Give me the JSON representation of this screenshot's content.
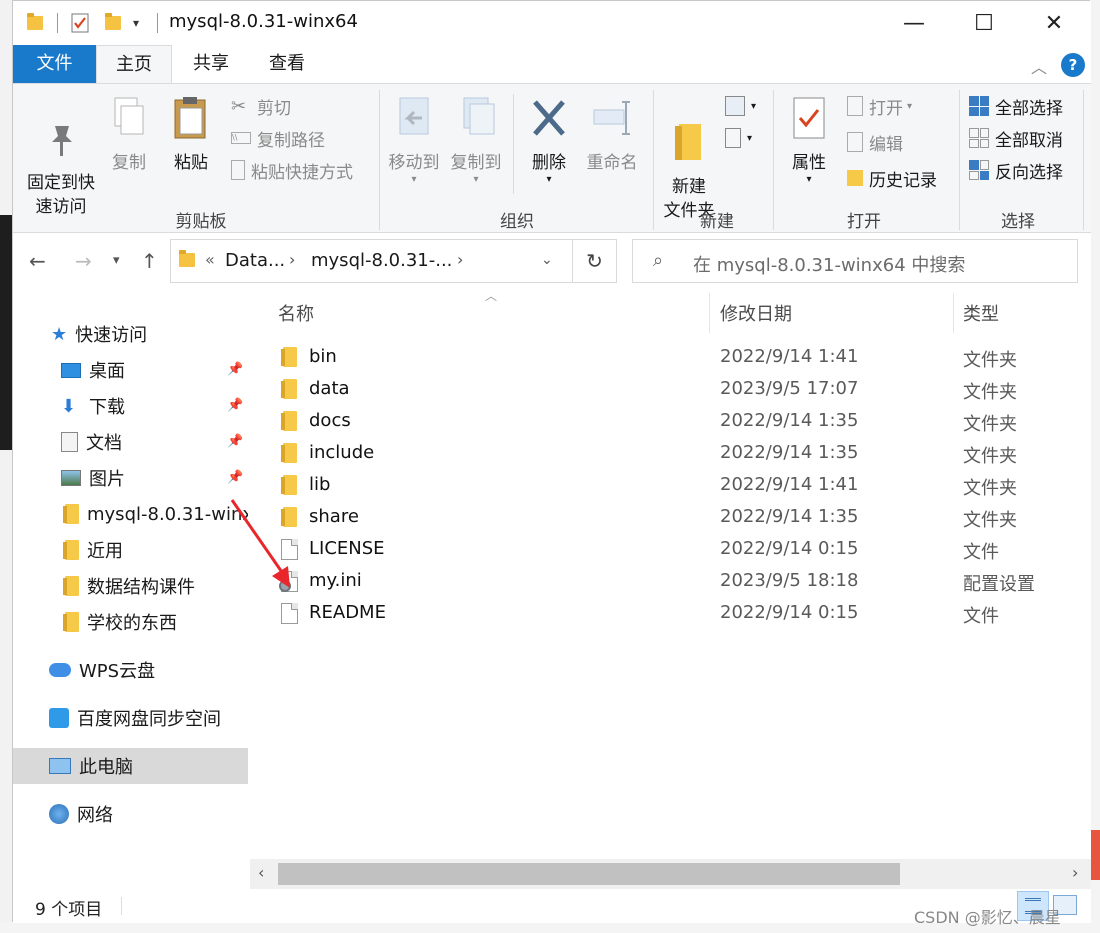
{
  "window": {
    "title": "mysql-8.0.31-winx64"
  },
  "window_controls": {
    "minimize": "—",
    "maximize": "☐",
    "close": "✕"
  },
  "tabs": {
    "file": "文件",
    "home": "主页",
    "share": "共享",
    "view": "查看"
  },
  "ribbon": {
    "clipboard": {
      "pin": "固定到快\n速访问",
      "copy": "复制",
      "paste": "粘贴",
      "cut": "剪切",
      "copy_path": "复制路径",
      "paste_shortcut": "粘贴快捷方式",
      "label": "剪贴板"
    },
    "organize": {
      "move_to": "移动到",
      "copy_to": "复制到",
      "delete": "删除",
      "rename": "重命名",
      "label": "组织"
    },
    "new": {
      "new_folder": "新建\n文件夹",
      "label": "新建"
    },
    "open": {
      "properties": "属性",
      "open": "打开",
      "edit": "编辑",
      "history": "历史记录",
      "label": "打开"
    },
    "select": {
      "select_all": "全部选择",
      "select_none": "全部取消",
      "invert": "反向选择",
      "label": "选择"
    }
  },
  "address": {
    "crumb_overflow": "«",
    "crumb1": "Data...",
    "crumb2": "mysql-8.0.31-...",
    "search_placeholder": "在 mysql-8.0.31-winx64 中搜索"
  },
  "nav": {
    "quick_access": "快速访问",
    "items": [
      "桌面",
      "下载",
      "文档",
      "图片",
      "mysql-8.0.31-winx",
      "近用",
      "数据结构课件",
      "学校的东西"
    ],
    "wps": "WPS云盘",
    "baidu": "百度网盘同步空间",
    "this_pc": "此电脑",
    "network": "网络"
  },
  "columns": {
    "name": "名称",
    "date": "修改日期",
    "type": "类型"
  },
  "files": [
    {
      "name": "bin",
      "date": "2022/9/14 1:41",
      "type": "文件夹",
      "kind": "folder"
    },
    {
      "name": "data",
      "date": "2023/9/5 17:07",
      "type": "文件夹",
      "kind": "folder"
    },
    {
      "name": "docs",
      "date": "2022/9/14 1:35",
      "type": "文件夹",
      "kind": "folder"
    },
    {
      "name": "include",
      "date": "2022/9/14 1:35",
      "type": "文件夹",
      "kind": "folder"
    },
    {
      "name": "lib",
      "date": "2022/9/14 1:41",
      "type": "文件夹",
      "kind": "folder"
    },
    {
      "name": "share",
      "date": "2022/9/14 1:35",
      "type": "文件夹",
      "kind": "folder"
    },
    {
      "name": "LICENSE",
      "date": "2022/9/14 0:15",
      "type": "文件",
      "kind": "file"
    },
    {
      "name": "my.ini",
      "date": "2023/9/5 18:18",
      "type": "配置设置",
      "kind": "ini"
    },
    {
      "name": "README",
      "date": "2022/9/14 0:15",
      "type": "文件",
      "kind": "file"
    }
  ],
  "status": {
    "count": "9 个项目"
  },
  "watermark": "CSDN @影忆、晨星",
  "colors": {
    "accent": "#1979ca",
    "ribbon_bg": "#f5f6f7",
    "annotation_arrow": "#e8262b"
  }
}
